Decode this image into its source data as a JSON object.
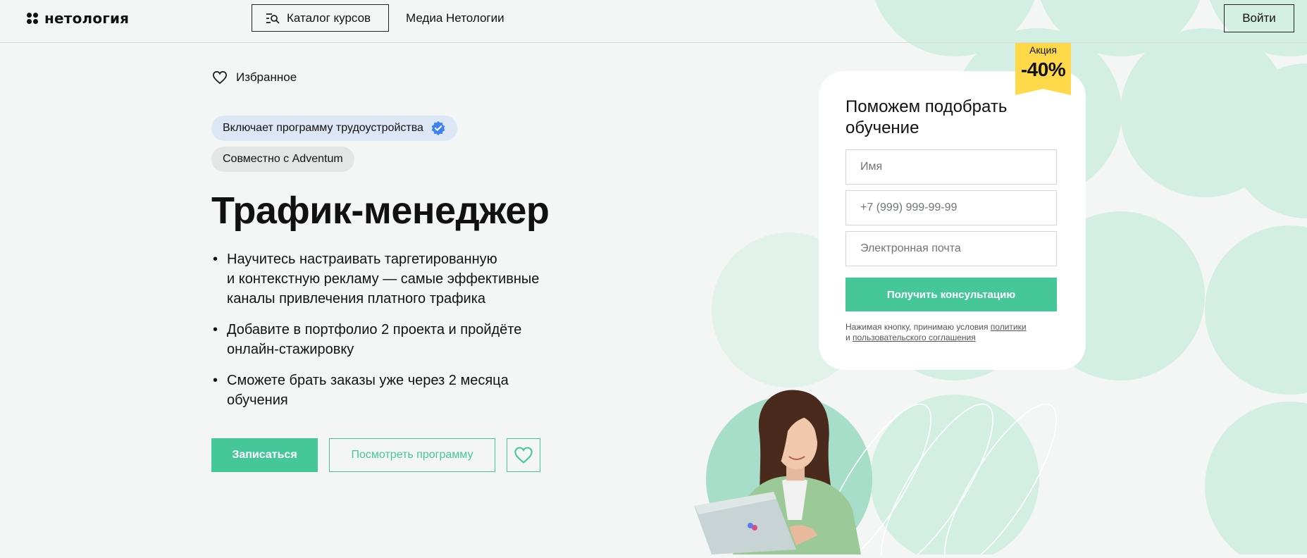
{
  "header": {
    "logo_text": "нетология",
    "catalog_label": "Каталог курсов",
    "media_label": "Медиа Нетологии",
    "login_label": "Войти"
  },
  "favorites_label": "Избранное",
  "badges": [
    {
      "label": "Включает программу трудоустройства",
      "icon": "verified-check-icon"
    },
    {
      "label": "Совместно с Adventum"
    }
  ],
  "course": {
    "title": "Трафик-менеджер",
    "bullets": [
      [
        "Научитесь настраивать таргетированную",
        "и контекстную рекламу — самые эффективные",
        "каналы привлечения платного трафика"
      ],
      [
        "Добавите в портфолио 2 проекта и пройдёте",
        "онлайн-стажировку"
      ],
      [
        "Сможете брать заказы уже через 2 месяца",
        "обучения"
      ]
    ],
    "enroll_label": "Записаться",
    "program_label": "Посмотреть программу"
  },
  "promo": {
    "label": "Акция",
    "value": "-40%"
  },
  "form": {
    "title": "Поможем подобрать обучение",
    "name_placeholder": "Имя",
    "phone_placeholder": "+7 (999) 999-99-99",
    "email_placeholder": "Электронная почта",
    "submit_label": "Получить консультацию",
    "consent_prefix": "Нажимая кнопку, принимаю условия",
    "consent_link1": "политики",
    "consent_mid": "и",
    "consent_link2": "пользовательского соглашения"
  },
  "colors": {
    "accent": "#45c79a",
    "promo": "#ffd94a",
    "badge_blue": "#dde6f4",
    "circle": "#cdeee0"
  }
}
